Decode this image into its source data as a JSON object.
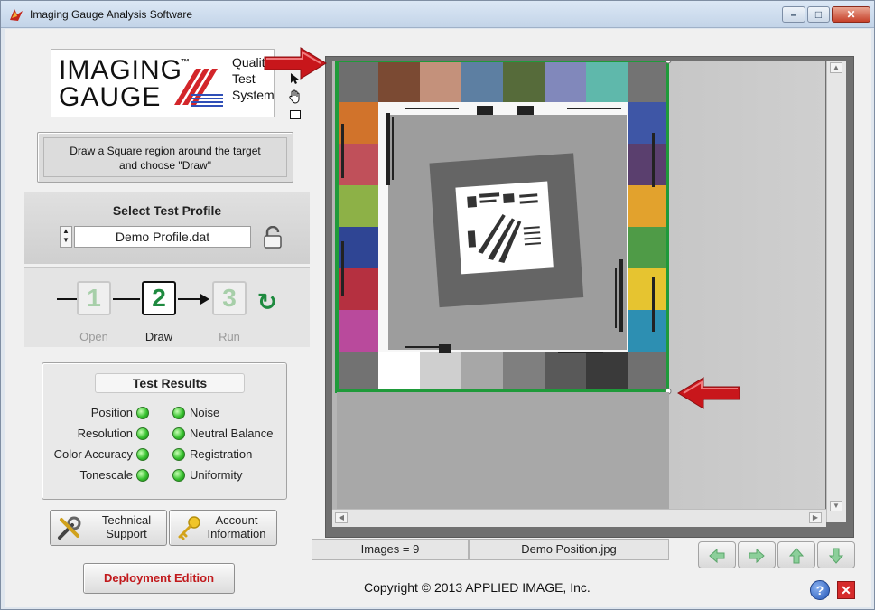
{
  "window": {
    "title": "Imaging Gauge Analysis Software",
    "minimize_glyph": "–",
    "maximize_glyph": "□",
    "close_glyph": "✕"
  },
  "logo": {
    "line1": "IMAGING",
    "tm": "™",
    "line2": "GAUGE",
    "sub1": "Quality",
    "sub2": "Test",
    "sub3": "System"
  },
  "tools": [
    "pointer-icon",
    "hand-icon",
    "rectangle-icon"
  ],
  "instruction": {
    "line1": "Draw a Square region around the target",
    "line2": "and choose \"Draw\""
  },
  "profile": {
    "title": "Select Test Profile",
    "value": "Demo Profile.dat"
  },
  "steps": [
    {
      "number": "1",
      "label": "Open",
      "active": false
    },
    {
      "number": "2",
      "label": "Draw",
      "active": true
    },
    {
      "number": "3",
      "label": "Run",
      "active": false
    }
  ],
  "results": {
    "title": "Test Results",
    "left": [
      "Position",
      "Resolution",
      "Color Accuracy",
      "Tonescale"
    ],
    "right": [
      "Noise",
      "Neutral Balance",
      "Registration",
      "Uniformity"
    ],
    "status_color": "#37c22f"
  },
  "buttons": {
    "technical_line1": "Technical",
    "technical_line2": "Support",
    "account_line1": "Account",
    "account_line2": "Information",
    "deployment": "Deployment Edition"
  },
  "viewer": {
    "images_count": "Images = 9",
    "filename": "Demo Position.jpg",
    "selection_color": "#1f9a3a",
    "top_patches": [
      "#6e6e6e",
      "#7b4a33",
      "#c4917b",
      "#5d7fa2",
      "#566b3a",
      "#8188bb",
      "#5fb8ab",
      "#737373"
    ],
    "left_patches": [
      "#d1732b",
      "#c0505a",
      "#8db147",
      "#2f4594",
      "#b53040",
      "#b94a9c",
      "#727272"
    ],
    "right_patches": [
      "#3e56a6",
      "#5a3f6e",
      "#e2a22d",
      "#4f9b47",
      "#e6c430",
      "#2d8fb2",
      "#737373"
    ],
    "bottom_patches": [
      "#ffffff",
      "#cfcfcf",
      "#a7a7a7",
      "#7f7f7f",
      "#595959",
      "#3a3a3a",
      "#707070"
    ]
  },
  "footer": {
    "copyright": "Copyright © 2013 APPLIED IMAGE, Inc.",
    "help_glyph": "?",
    "close_glyph": "✕"
  }
}
